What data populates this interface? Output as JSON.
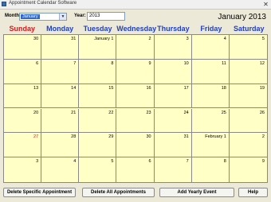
{
  "window": {
    "title": "Appointment Calendar Software",
    "close_glyph": "✕"
  },
  "toolbar": {
    "month_label": "Month:",
    "month_value": "January",
    "year_label": "Year:",
    "year_value": "2013"
  },
  "header": {
    "month_year": "January 2013"
  },
  "weekdays": [
    "Sunday",
    "Monday",
    "Tuesday",
    "Wednesday",
    "Thursday",
    "Friday",
    "Saturday"
  ],
  "weeks": [
    [
      "30",
      "31",
      "January 1",
      "2",
      "3",
      "4",
      "5"
    ],
    [
      "6",
      "7",
      "8",
      "9",
      "10",
      "11",
      "12"
    ],
    [
      "13",
      "14",
      "15",
      "16",
      "17",
      "18",
      "19"
    ],
    [
      "20",
      "21",
      "22",
      "23",
      "24",
      "25",
      "26"
    ],
    [
      "27",
      "28",
      "29",
      "30",
      "31",
      "February 1",
      "2"
    ],
    [
      "3",
      "4",
      "5",
      "6",
      "7",
      "8",
      "9"
    ]
  ],
  "highlight": {
    "week": 4,
    "day": 0,
    "color": "#d01c1c"
  },
  "buttons": {
    "delete_specific": "Delete Specific Appointment",
    "delete_all": "Delete All Appointments",
    "add_yearly": "Add Yearly Event",
    "help": "Help"
  }
}
